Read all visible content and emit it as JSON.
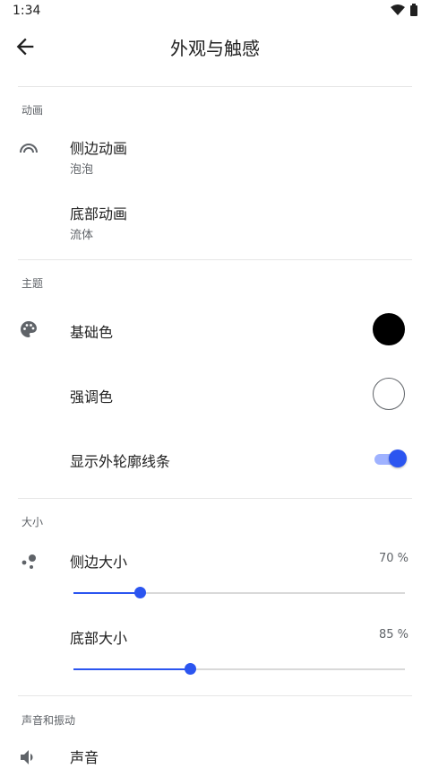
{
  "status": {
    "time": "1:34",
    "wifi_icon": "wifi-icon",
    "battery_icon": "battery-icon"
  },
  "appbar": {
    "title": "外观与触感",
    "back_icon": "arrow-left-icon"
  },
  "sections": {
    "animation": {
      "label": "动画"
    },
    "theme": {
      "label": "主题"
    },
    "size": {
      "label": "大小"
    },
    "sound": {
      "label": "声音和振动"
    }
  },
  "rows": {
    "side_animation": {
      "title": "侧边动画",
      "value": "泡泡"
    },
    "bottom_animation": {
      "title": "底部动画",
      "value": "流体"
    },
    "base_color": {
      "title": "基础色",
      "color": "#000000"
    },
    "accent_color": {
      "title": "强调色",
      "color": "#ffffff"
    },
    "outline": {
      "title": "显示外轮廓线条",
      "enabled": true
    },
    "side_size": {
      "title": "侧边大小",
      "value": "70 %",
      "level": 0.2
    },
    "bottom_size": {
      "title": "底部大小",
      "value": "85 %",
      "level": 0.35
    },
    "sound": {
      "title": "声音"
    }
  },
  "colors": {
    "accent": "#2b55f0"
  }
}
